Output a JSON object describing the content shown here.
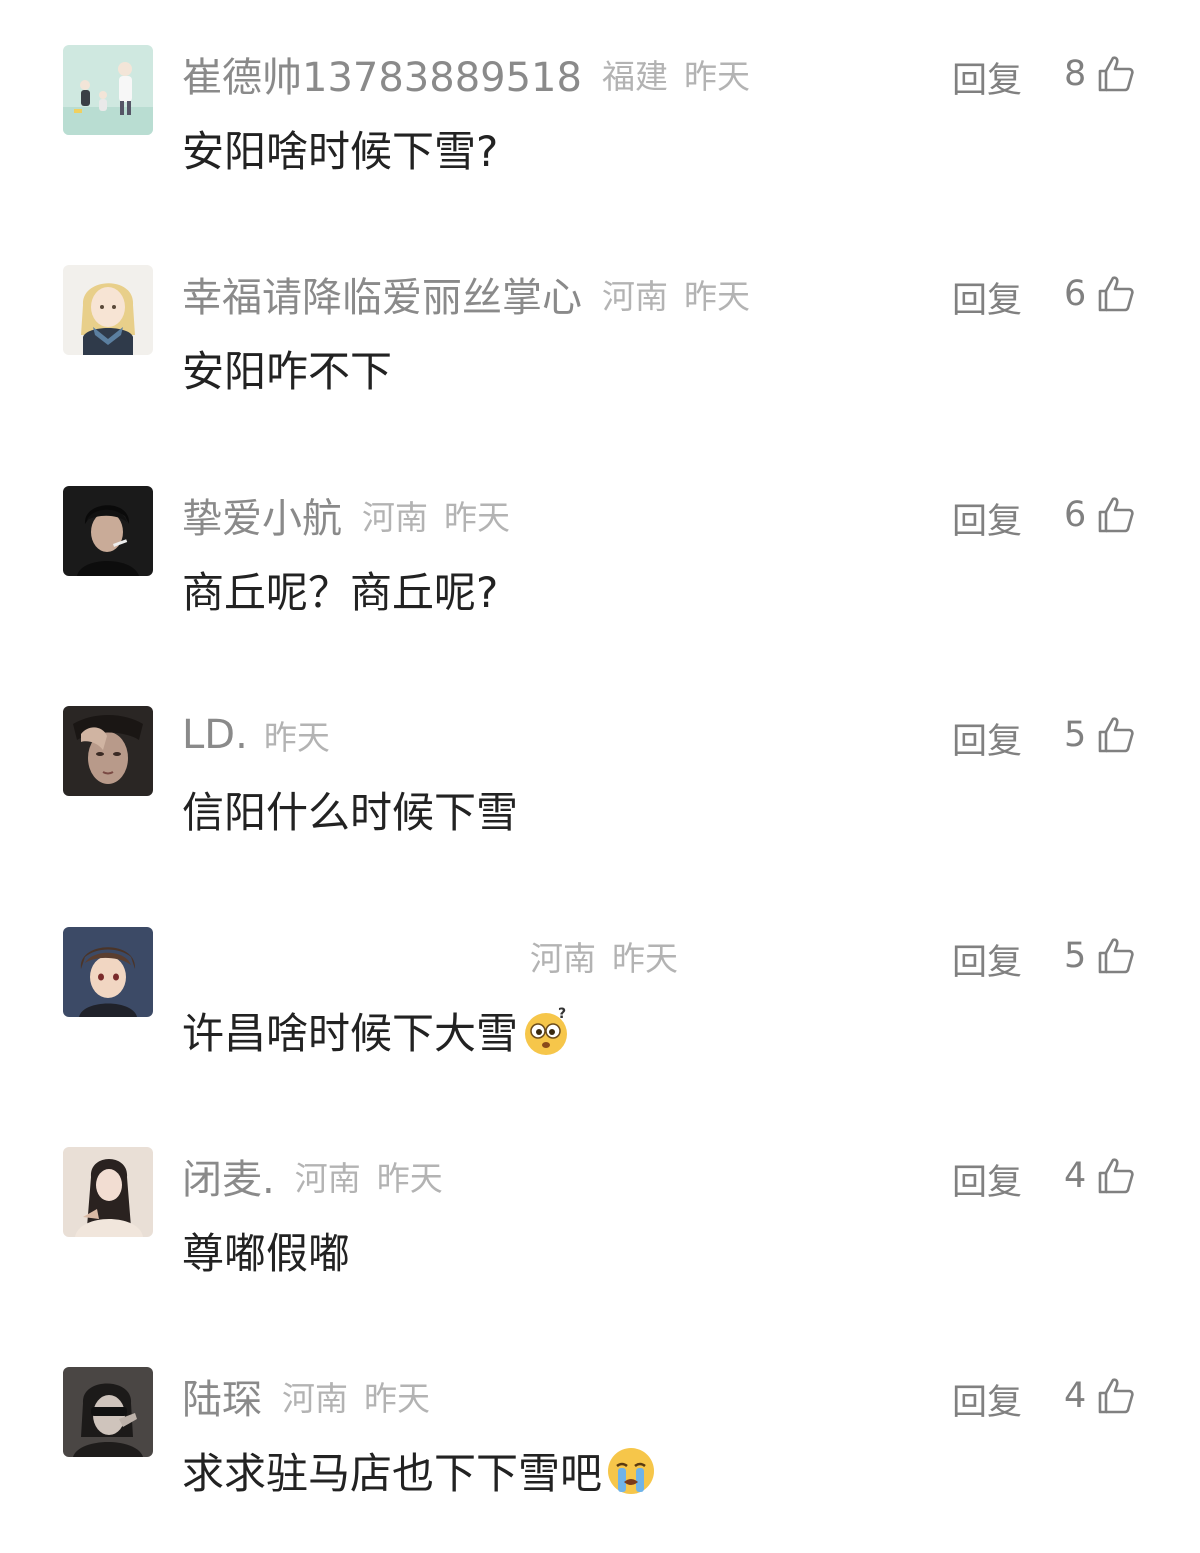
{
  "comments": [
    {
      "username": "崔德帅13783889518",
      "region": "福建",
      "time": "昨天",
      "content": "安阳啥时候下雪?",
      "reply_label": "回复",
      "likes": "8",
      "avatar": "avatar-cartoon-family-icon"
    },
    {
      "username": "幸福请降临爱丽丝掌心",
      "region": "河南",
      "time": "昨天",
      "content": "安阳咋不下",
      "reply_label": "回复",
      "likes": "6",
      "avatar": "avatar-anime-girl-icon"
    },
    {
      "username": "挚爱小航",
      "region": "河南",
      "time": "昨天",
      "content": "商丘呢？商丘呢?",
      "reply_label": "回复",
      "likes": "6",
      "avatar": "avatar-young-man-icon"
    },
    {
      "username": "LD.",
      "region": "",
      "time": "昨天",
      "content": "信阳什么时候下雪",
      "reply_label": "回复",
      "likes": "5",
      "avatar": "avatar-hand-face-icon"
    },
    {
      "username": "",
      "region": "河南",
      "time": "昨天",
      "content": "许昌啥时候下大雪",
      "reply_label": "回复",
      "likes": "5",
      "avatar": "avatar-anime-boy-icon",
      "emoji": "confused-face-emoji"
    },
    {
      "username": "闭麦.",
      "region": "河南",
      "time": "昨天",
      "content": "尊嘟假嘟",
      "reply_label": "回复",
      "likes": "4",
      "avatar": "avatar-girl-photo-icon"
    },
    {
      "username": "陆琛",
      "region": "河南",
      "time": "昨天",
      "content": "求求驻马店也下下雪吧",
      "reply_label": "回复",
      "likes": "4",
      "avatar": "avatar-dark-portrait-icon",
      "emoji": "crying-face-emoji"
    }
  ],
  "colors": {
    "username": "#8a8a8a",
    "meta": "#b3b3b3",
    "content": "#222222",
    "action": "#808080"
  }
}
